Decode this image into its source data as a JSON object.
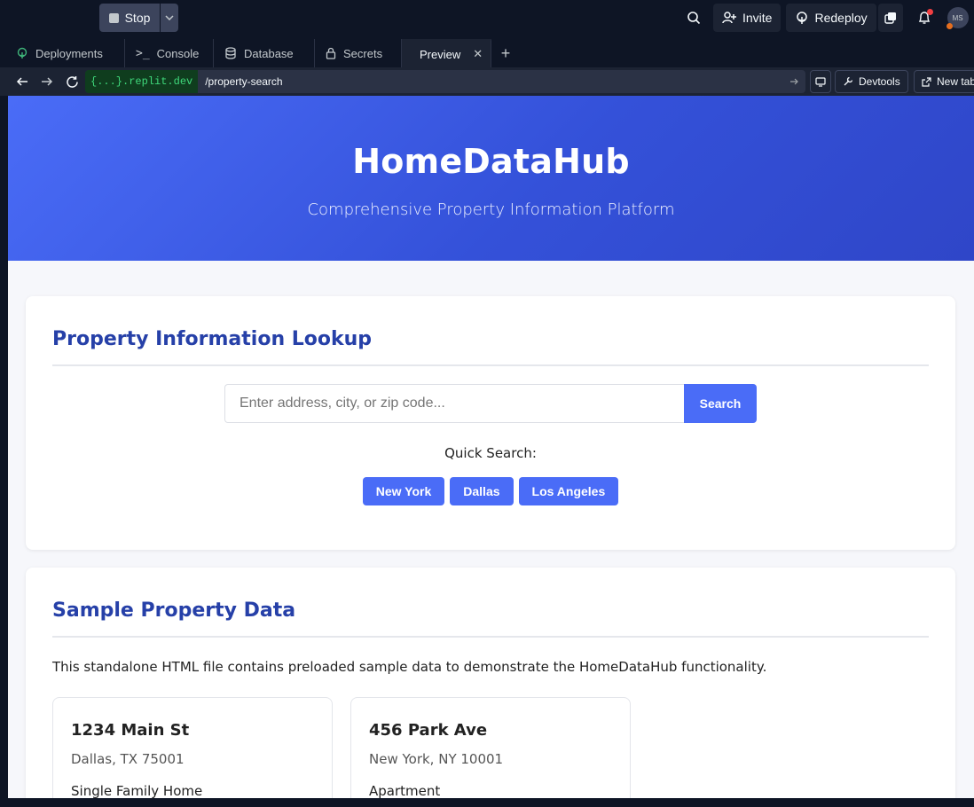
{
  "topbar": {
    "stop_label": "Stop",
    "invite_label": "Invite",
    "redeploy_label": "Redeploy",
    "avatar_initials": "MS"
  },
  "tabs": [
    {
      "label": "Deployments",
      "icon": "deployments-icon"
    },
    {
      "label": "Console",
      "icon": "console-icon"
    },
    {
      "label": "Database",
      "icon": "database-icon"
    },
    {
      "label": "Secrets",
      "icon": "lock-icon"
    },
    {
      "label": "Preview",
      "icon": "monitor-icon",
      "active": true
    }
  ],
  "address": {
    "host": "{...}.replit.dev",
    "path": "/property-search",
    "devtools_label": "Devtools",
    "new_tab_label": "New tab"
  },
  "page": {
    "hero": {
      "title": "HomeDataHub",
      "subtitle": "Comprehensive Property Information Platform"
    },
    "lookup": {
      "heading": "Property Information Lookup",
      "search_placeholder": "Enter address, city, or zip code...",
      "search_button": "Search",
      "quick_label": "Quick Search:",
      "quick_buttons": [
        "New York",
        "Dallas",
        "Los Angeles"
      ]
    },
    "sample": {
      "heading": "Sample Property Data",
      "description": "This standalone HTML file contains preloaded sample data to demonstrate the HomeDataHub functionality.",
      "properties": [
        {
          "address": "1234 Main St",
          "city": "Dallas, TX 75001",
          "type": "Single Family Home"
        },
        {
          "address": "456 Park Ave",
          "city": "New York, NY 10001",
          "type": "Apartment"
        }
      ]
    }
  },
  "colors": {
    "ide_bg": "#0e1525",
    "accent": "#4a6cf7",
    "heading": "#2640a8"
  }
}
